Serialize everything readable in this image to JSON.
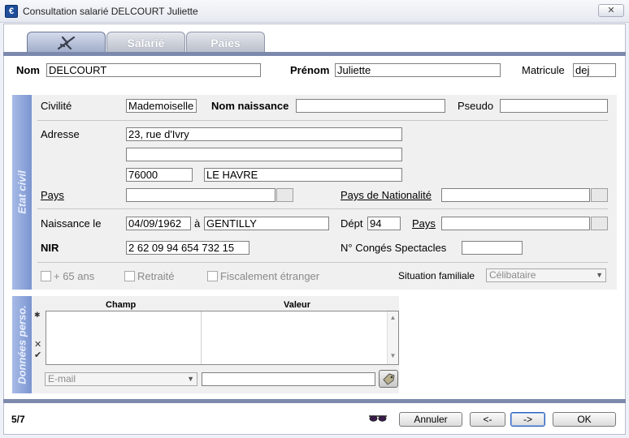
{
  "window": {
    "title": "Consultation salarié DELCOURT Juliette",
    "close_label": "✕"
  },
  "tabs": [
    {
      "label": "",
      "icon": "plane-icon"
    },
    {
      "label": "Salarié"
    },
    {
      "label": "Paies"
    }
  ],
  "header": {
    "nom_label": "Nom",
    "nom_value": "DELCOURT",
    "prenom_label": "Prénom",
    "prenom_value": "Juliette",
    "matricule_label": "Matricule",
    "matricule_value": "dej"
  },
  "etat_civil": {
    "band_label": "Etat civil",
    "civilite_label": "Civilité",
    "civilite_value": "Mademoiselle",
    "nom_naissance_label": "Nom naissance",
    "nom_naissance_value": "",
    "pseudo_label": "Pseudo",
    "pseudo_value": "",
    "adresse_label": "Adresse",
    "adresse_line1": "23, rue d'Ivry",
    "adresse_line2": "",
    "code_postal": "76000",
    "ville": "LE HAVRE",
    "pays_label": "Pays",
    "pays_value": "",
    "nationalite_label": "Pays de Nationalité",
    "nationalite_value": "",
    "naissance_label": "Naissance le",
    "naissance_date": "04/09/1962",
    "a_label": "à",
    "naissance_lieu": "GENTILLY",
    "dept_label": "Dépt",
    "dept_value": "94",
    "pays_naissance_label": "Pays",
    "pays_naissance_value": "",
    "nir_label": "NIR",
    "nir_value": "2 62 09 94 654 732 15",
    "conges_label": "N° Congés Spectacles",
    "conges_value": "",
    "plus65_label": "+ 65 ans",
    "retraite_label": "Retraité",
    "fiscal_label": "Fiscalement étranger",
    "situation_label": "Situation familiale",
    "situation_value": "Célibataire"
  },
  "donnees_perso": {
    "band_label": "Données perso.",
    "col_champ": "Champ",
    "col_valeur": "Valeur",
    "type_value": "E-mail",
    "input_value": ""
  },
  "footer": {
    "record_counter": "5/7",
    "annuler_label": "Annuler",
    "prev_label": "<-",
    "next_label": "->",
    "ok_label": "OK"
  },
  "colors": {
    "accent": "#7c89ad",
    "band": "#8ea4db"
  }
}
